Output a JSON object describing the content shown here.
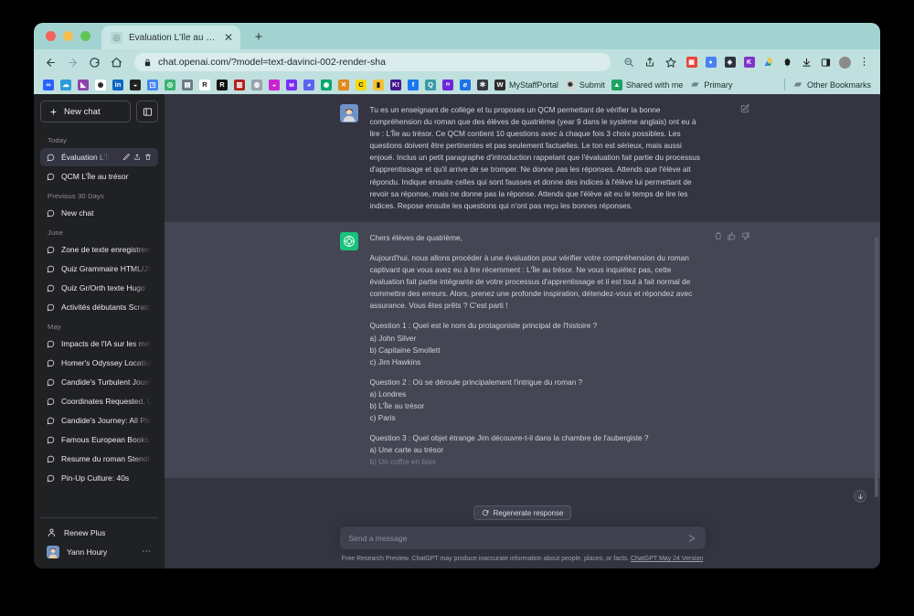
{
  "browser": {
    "tab": {
      "title": "Évaluation L'Île au trésor.",
      "favicon_icon": "chatgpt-favicon",
      "close_icon": "close-icon"
    },
    "new_tab_icon": "plus-icon",
    "nav": {
      "back_icon": "arrow-left-icon",
      "forward_icon": "arrow-right-icon",
      "reload_icon": "reload-icon",
      "home_icon": "home-icon"
    },
    "omnibox": {
      "lock_icon": "lock-icon",
      "url": "chat.openai.com/?model=text-davinci-002-render-sha",
      "zoom_icon": "zoom-out-icon",
      "share_icon": "share-icon",
      "bookmark_icon": "star-icon"
    },
    "toolbar_right": [
      {
        "name": "extension-icon-red",
        "color": "#e8453c",
        "glyph": "▦"
      },
      {
        "name": "extension-icon-blue",
        "color": "#4a80f0",
        "glyph": "●"
      },
      {
        "name": "extension-icon-dark",
        "color": "#2b3440",
        "glyph": "◈"
      },
      {
        "name": "extension-icon-purple",
        "color": "#8034c8",
        "glyph": "K"
      },
      {
        "name": "google-drive-icon",
        "color": "#1ea362",
        "glyph": "▲"
      },
      {
        "name": "extensions-puzzle-icon",
        "color": "#1c1c1c",
        "glyph": "✚"
      },
      {
        "name": "downloads-icon",
        "color": "#1c1c1c",
        "glyph": "⤓"
      },
      {
        "name": "sidepanel-icon",
        "color": "#1c1c1c",
        "glyph": "▯"
      },
      {
        "name": "profile-avatar-icon",
        "color": "#6b6b6b",
        "glyph": "●"
      },
      {
        "name": "chrome-menu-icon",
        "color": "#1c1c1c",
        "glyph": "⋮"
      }
    ],
    "bookmarks": [
      {
        "label": "",
        "name": "bookmark-infinity",
        "color": "#2962ff",
        "glyph": "∞"
      },
      {
        "label": "",
        "name": "bookmark-cloud",
        "color": "#2d9cdb",
        "glyph": "☁"
      },
      {
        "label": "",
        "name": "bookmark-drop",
        "color": "#8e44ad",
        "glyph": "◣"
      },
      {
        "label": "",
        "name": "bookmark-github",
        "color": "#ffffff",
        "glyph": "◉"
      },
      {
        "label": "",
        "name": "bookmark-linkedin",
        "color": "#0a66c2",
        "glyph": "in"
      },
      {
        "label": "",
        "name": "bookmark-chat",
        "color": "#222222",
        "glyph": "◒"
      },
      {
        "label": "",
        "name": "bookmark-search-doc",
        "color": "#4285f4",
        "glyph": "◳"
      },
      {
        "label": "",
        "name": "bookmark-robot-green",
        "color": "#3cb371",
        "glyph": "◎"
      },
      {
        "label": "",
        "name": "bookmark-grid",
        "color": "#6b7a86",
        "glyph": "▤"
      },
      {
        "label": "",
        "name": "bookmark-r-light",
        "color": "#ffffff",
        "glyph": "R"
      },
      {
        "label": "",
        "name": "bookmark-r-dark",
        "color": "#111111",
        "glyph": "R"
      },
      {
        "label": "",
        "name": "bookmark-books-red",
        "color": "#b22222",
        "glyph": "▥"
      },
      {
        "label": "",
        "name": "bookmark-globe-grey",
        "color": "#99a3ad",
        "glyph": "◍"
      },
      {
        "label": "",
        "name": "bookmark-chat-magenta",
        "color": "#c925d1",
        "glyph": "◒"
      },
      {
        "label": "",
        "name": "bookmark-m-violet",
        "color": "#7b2ff7",
        "glyph": "ᴍ"
      },
      {
        "label": "",
        "name": "bookmark-discord",
        "color": "#5865f2",
        "glyph": "◕"
      },
      {
        "label": "",
        "name": "bookmark-mint",
        "color": "#00a86b",
        "glyph": "◉"
      },
      {
        "label": "",
        "name": "bookmark-x-orange",
        "color": "#e08a1e",
        "glyph": "✕"
      },
      {
        "label": "",
        "name": "bookmark-yellow-c",
        "color": "#f5d90a",
        "glyph": "C"
      },
      {
        "label": "",
        "name": "bookmark-yellow-note",
        "color": "#f2c230",
        "glyph": "▮"
      },
      {
        "label": "",
        "name": "bookmark-kahoot",
        "color": "#46178f",
        "glyph": "K!"
      },
      {
        "label": "",
        "name": "bookmark-f-blue",
        "color": "#1877f2",
        "glyph": "f"
      },
      {
        "label": "",
        "name": "bookmark-q-teal",
        "color": "#3a9ba8",
        "glyph": "Q"
      },
      {
        "label": "",
        "name": "bookmark-m-purple",
        "color": "#6d28d9",
        "glyph": "ᵐ"
      },
      {
        "label": "",
        "name": "bookmark-e-blue",
        "color": "#1a73e8",
        "glyph": "ℯ"
      },
      {
        "label": "",
        "name": "bookmark-bug-dark",
        "color": "#333a45",
        "glyph": "✻"
      },
      {
        "label": "MyStaffPortal",
        "name": "bookmark-mystaffportal",
        "color": "#2d2d2d",
        "glyph": "W"
      },
      {
        "label": "Submit",
        "name": "bookmark-submit",
        "color": "#cfd8d8",
        "glyph": "❋"
      },
      {
        "label": "Shared with me",
        "name": "bookmark-shared-with-me",
        "color": "#1ea362",
        "glyph": "▲"
      },
      {
        "label": "Primary",
        "name": "bookmark-folder-primary",
        "color": "#8fa2ad",
        "glyph": "▰"
      }
    ],
    "other_bookmarks": {
      "label": "Other Bookmarks",
      "name": "bookmark-folder-other",
      "glyph": "▰"
    }
  },
  "sidebar": {
    "new_chat_label": "New chat",
    "new_chat_icon": "plus-icon",
    "collapse_icon": "sidebar-toggle-icon",
    "groups": [
      {
        "label": "Today",
        "items": [
          {
            "label": "Évaluation L'Île au tré",
            "active": true,
            "actions": [
              "edit-icon",
              "share-icon",
              "trash-icon"
            ]
          },
          {
            "label": "QCM L'Île au trésor",
            "active": false,
            "actions": []
          }
        ]
      },
      {
        "label": "Previous 30 Days",
        "items": [
          {
            "label": "New chat",
            "active": false,
            "actions": []
          }
        ]
      },
      {
        "label": "June",
        "items": [
          {
            "label": "Zone de texte enregistrement.",
            "active": false,
            "actions": []
          },
          {
            "label": "Quiz Grammaire HTML/JS",
            "active": false,
            "actions": []
          },
          {
            "label": "Quiz Gr/Orth texte Hugo",
            "active": false,
            "actions": []
          },
          {
            "label": "Activités débutants Scratch.",
            "active": false,
            "actions": []
          }
        ]
      },
      {
        "label": "May",
        "items": [
          {
            "label": "Impacts de l'IA sur les métiers",
            "active": false,
            "actions": []
          },
          {
            "label": "Homer's Odyssey Locations",
            "active": false,
            "actions": []
          },
          {
            "label": "Candide's Turbulent Journey",
            "active": false,
            "actions": []
          },
          {
            "label": "Coordinates Requested, Unable",
            "active": false,
            "actions": []
          },
          {
            "label": "Candide's Journey: All Places",
            "active": false,
            "actions": []
          },
          {
            "label": "Famous European Books List",
            "active": false,
            "actions": []
          },
          {
            "label": "Resume du roman Stendhal",
            "active": false,
            "actions": []
          },
          {
            "label": "Pin-Up Culture: 40s",
            "active": false,
            "actions": []
          }
        ]
      }
    ],
    "renew_plus_label": "Renew Plus",
    "renew_plus_icon": "person-icon",
    "user_name": "Yann Houry",
    "user_menu_icon": "ellipsis-icon"
  },
  "chat": {
    "user_message": {
      "avatar_name": "user-avatar",
      "edit_icon": "edit-icon",
      "text": "Tu es un enseignant de collège et tu proposes un QCM permettant de vérifier la bonne compréhension du roman que des élèves de quatrième (year 9 dans le système anglais) ont eu à lire : L'Île au trésor. Ce QCM contient 10 questions avec à chaque fois 3 choix possibles. Les questions doivent être pertinentes et pas seulement factuelles. Le ton est sérieux, mais aussi enjoué. Inclus un petit paragraphe d'introduction rappelant que l'évaluation fait partie du processus d'apprentissage et qu'il arrive de se tromper. Ne donne pas les réponses. Attends que l'élève ait répondu. Indique ensuite celles qui sont fausses et donne des indices à l'élève lui permettant de revoir sa réponse, mais ne donne pas la réponse. Attends que l'élève ait eu le temps de lire les indices. Repose ensuite les questions qui n'ont pas reçu les bonnes réponses."
    },
    "assistant_message": {
      "avatar_name": "chatgpt-avatar",
      "actions": [
        "copy-icon",
        "thumbs-up-icon",
        "thumbs-down-icon"
      ],
      "greeting": "Chers élèves de quatrième,",
      "intro": "Aujourd'hui, nous allons procéder à une évaluation pour vérifier votre compréhension du roman captivant que vous avez eu à lire récemment : L'Île au trésor. Ne vous inquiétez pas, cette évaluation fait partie intégrante de votre processus d'apprentissage et il est tout à fait normal de commettre des erreurs. Alors, prenez une profonde inspiration, détendez-vous et répondez avec assurance. Vous êtes prêts ? C'est parti !",
      "questions": [
        {
          "prompt": "Question 1 : Quel est le nom du protagoniste principal de l'histoire ?",
          "choices": [
            "a) John Silver",
            "b) Capitaine Smollett",
            "c) Jim Hawkins"
          ]
        },
        {
          "prompt": "Question 2 : Où se déroule principalement l'intrigue du roman ?",
          "choices": [
            "a) Londres",
            "b) L'Île au trésor",
            "c) Paris"
          ]
        },
        {
          "prompt": "Question 3 : Quel objet étrange Jim découvre-t-il dans la chambre de l'aubergiste ?",
          "choices": [
            "a) Une carte au trésor",
            "b) Un coffre en bois"
          ]
        }
      ]
    }
  },
  "composer": {
    "regenerate_label": "Regenerate response",
    "regenerate_icon": "refresh-icon",
    "placeholder": "Send a message",
    "value": "",
    "send_icon": "send-icon",
    "scroll_bottom_icon": "arrow-down-icon",
    "footer_text": "Free Research Preview. ChatGPT may produce inaccurate information about people, places, or facts.",
    "footer_link": "ChatGPT May 24 Version"
  },
  "theme": {
    "page_bg": "#343541",
    "sidebar_bg": "#202123",
    "assistant_bg": "#444654",
    "accent_green": "#19c37d",
    "browser_chrome": "#bfe0de"
  }
}
